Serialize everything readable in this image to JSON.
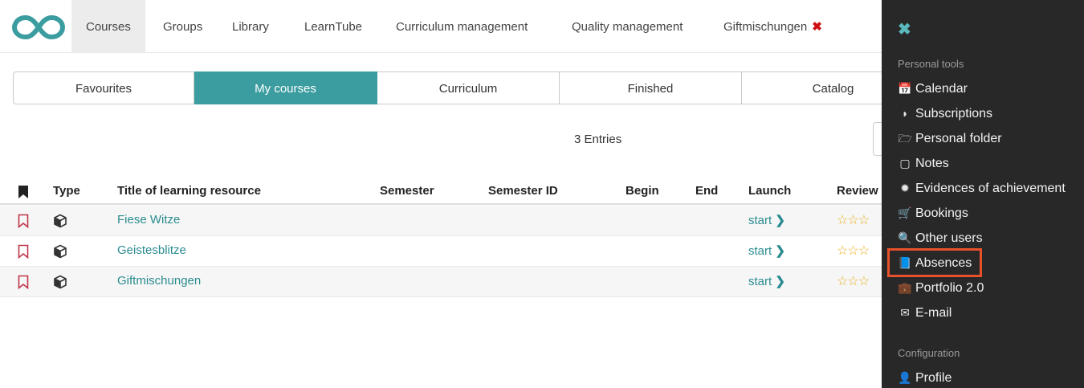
{
  "nav": {
    "items": [
      "Courses",
      "Groups",
      "Library",
      "LearnTube",
      "Curriculum management",
      "Quality management",
      "Giftmischungen"
    ],
    "close_icon": "✖"
  },
  "tabs": [
    "Favourites",
    "My courses",
    "Curriculum",
    "Finished",
    "Catalog"
  ],
  "entries_text": "3 Entries",
  "table": {
    "headers": [
      "Type",
      "Title of learning resource",
      "Semester",
      "Semester ID",
      "Begin",
      "End",
      "Launch",
      "Review"
    ],
    "rows": [
      {
        "title": "Fiese Witze",
        "launch": "start",
        "stars": "☆☆☆"
      },
      {
        "title": "Geistesblitze",
        "launch": "start",
        "stars": "☆☆☆"
      },
      {
        "title": "Giftmischungen",
        "launch": "start",
        "stars": "☆☆☆"
      }
    ]
  },
  "panel": {
    "close_icon": "✖",
    "section_personal": "Personal tools",
    "items": [
      {
        "label": "Calendar",
        "icon": "📅"
      },
      {
        "label": "Subscriptions",
        "icon": "◗"
      },
      {
        "label": "Personal folder",
        "icon": "🗁"
      },
      {
        "label": "Notes",
        "icon": "▢"
      },
      {
        "label": "Evidences of achievement",
        "icon": "✹"
      },
      {
        "label": "Bookings",
        "icon": "🛒"
      },
      {
        "label": "Other users",
        "icon": "🔍"
      },
      {
        "label": "Absences",
        "icon": "📘"
      },
      {
        "label": "Portfolio 2.0",
        "icon": "💼"
      },
      {
        "label": "E-mail",
        "icon": "✉"
      }
    ],
    "section_config": "Configuration",
    "profile": {
      "label": "Profile",
      "icon": "👤"
    }
  },
  "colors": {
    "accent": "#3c9da0",
    "panel_bg": "#282828",
    "highlight": "#e8512a",
    "bookmark": "#c0344a",
    "stars": "#e8b020"
  }
}
